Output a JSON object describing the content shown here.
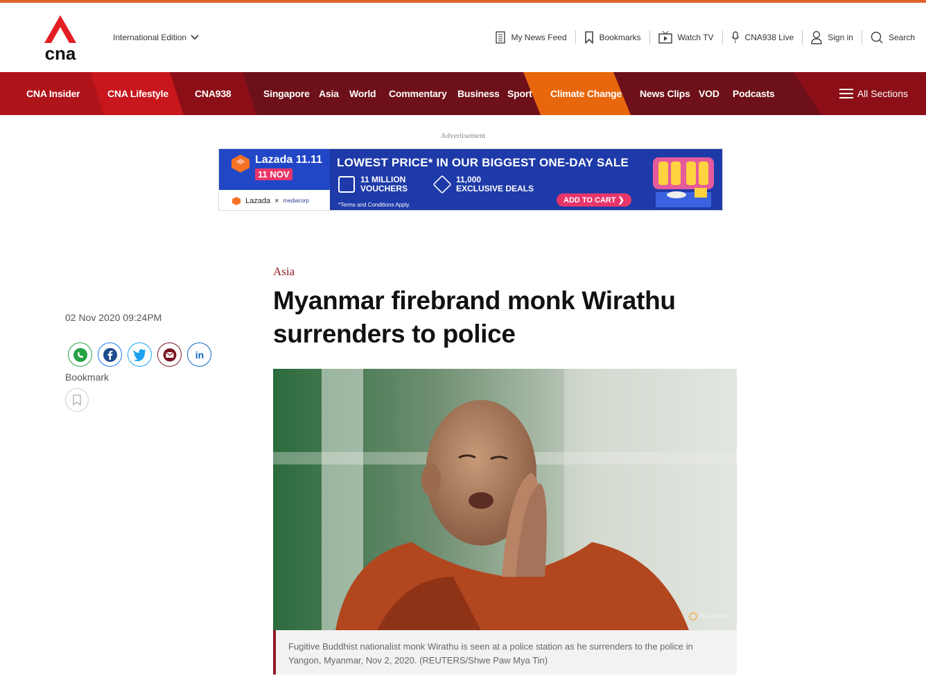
{
  "header": {
    "edition": "International Edition",
    "nav": [
      {
        "label": "My News Feed",
        "icon": "news-feed-icon"
      },
      {
        "label": "Bookmarks",
        "icon": "bookmark-icon"
      },
      {
        "label": "Watch TV",
        "icon": "tv-icon"
      },
      {
        "label": "CNA938 Live",
        "icon": "microphone-icon"
      },
      {
        "label": "Sign in",
        "icon": "user-icon"
      },
      {
        "label": "Search",
        "icon": "search-icon"
      }
    ]
  },
  "sections": {
    "items": [
      "CNA Insider",
      "CNA Lifestyle",
      "CNA938",
      "Singapore",
      "Asia",
      "World",
      "Commentary",
      "Business",
      "Sport",
      "Climate Change",
      "News Clips",
      "VOD",
      "Podcasts"
    ],
    "all_sections": "All Sections"
  },
  "ad": {
    "label": "Advertisement",
    "brand": "Lazada 11.11",
    "date_badge": "11 NOV",
    "headline": "LOWEST PRICE* IN OUR BIGGEST ONE-DAY SALE",
    "deal1_line1": "11 MILLION",
    "deal1_line2": "VOUCHERS",
    "deal2_line1": "11,000",
    "deal2_line2": "EXCLUSIVE DEALS",
    "partner_lazada": "Lazada",
    "partner_x": "×",
    "partner_mediacorp": "mediacorp",
    "terms": "*Terms and Conditions Apply.",
    "cta": "ADD TO CART"
  },
  "article": {
    "category": "Asia",
    "title": "Myanmar firebrand monk Wirathu surrenders to police",
    "date": "02 Nov 2020 09:24PM",
    "bookmark_label": "Bookmark",
    "photo_credit": "REUTERS",
    "caption": "Fugitive Buddhist nationalist monk Wirathu is seen at a police station as he surrenders to the police in Yangon, Myanmar, Nov 2, 2020. (REUTERS/Shwe Paw Mya Tin)"
  },
  "colors": {
    "accent": "#8e1b28",
    "nav_dark": "#6e1019",
    "nav_red": "#c8161d",
    "climate": "#e8670c",
    "topline": "#e0632d"
  }
}
